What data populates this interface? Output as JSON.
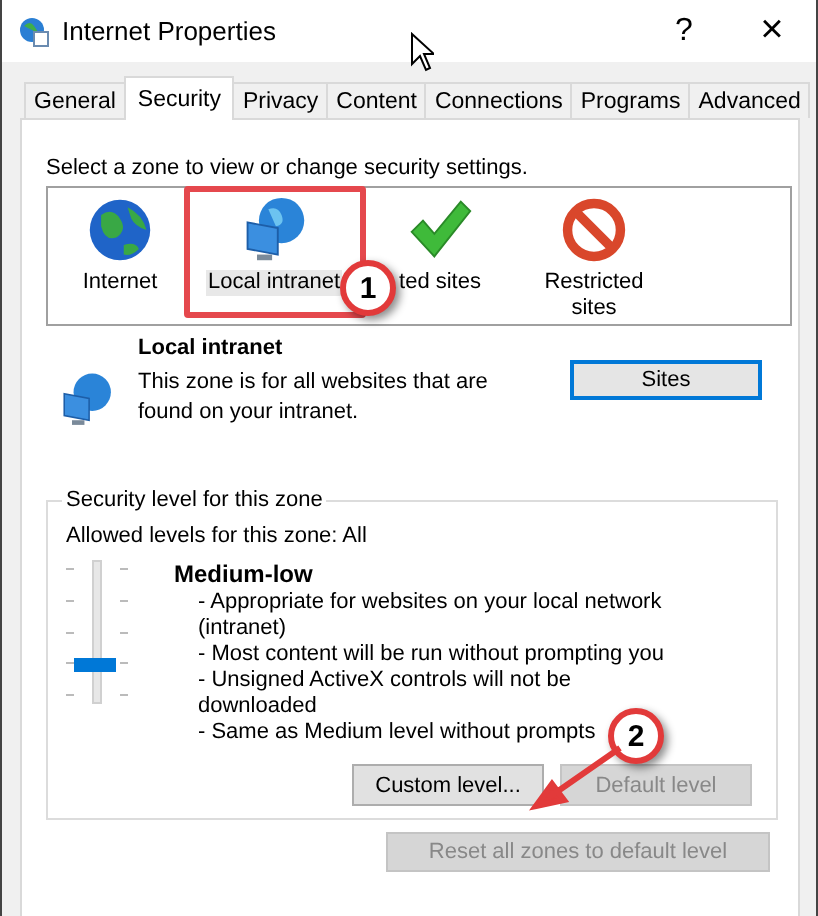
{
  "window": {
    "title": "Internet Properties",
    "help": "?",
    "close": "×"
  },
  "tabs": [
    {
      "label": "General",
      "selected": false
    },
    {
      "label": "Security",
      "selected": true
    },
    {
      "label": "Privacy",
      "selected": false
    },
    {
      "label": "Content",
      "selected": false
    },
    {
      "label": "Connections",
      "selected": false
    },
    {
      "label": "Programs",
      "selected": false
    },
    {
      "label": "Advanced",
      "selected": false
    }
  ],
  "instruction": "Select a zone to view or change security settings.",
  "zones": [
    {
      "label": "Internet",
      "kind": "globe",
      "selected": false
    },
    {
      "label": "Local intranet",
      "kind": "intranet",
      "selected": true
    },
    {
      "label": "ted sites",
      "kind": "trusted",
      "selected": false
    },
    {
      "label": "Restricted sites",
      "kind": "restricted",
      "selected": false
    }
  ],
  "zone_detail": {
    "title": "Local intranet",
    "description": "This zone is for all websites that are found on your intranet.",
    "sites_button": "Sites"
  },
  "security_level": {
    "legend": "Security level for this zone",
    "allowed": "Allowed levels for this zone: All",
    "slider": {
      "level": 0.25
    },
    "level_name": "Medium-low",
    "bullets": [
      "- Appropriate for websites on your local network (intranet)",
      "- Most content will be run without prompting you",
      "- Unsigned ActiveX controls will not be downloaded",
      "- Same as Medium level without prompts"
    ],
    "buttons": [
      {
        "label": "Custom level...",
        "disabled": false
      },
      {
        "label": "Default level",
        "disabled": true
      }
    ]
  },
  "reset_button": {
    "label": "Reset all zones to default level",
    "disabled": true
  },
  "annotations": [
    {
      "label": "1"
    },
    {
      "label": "2"
    }
  ]
}
